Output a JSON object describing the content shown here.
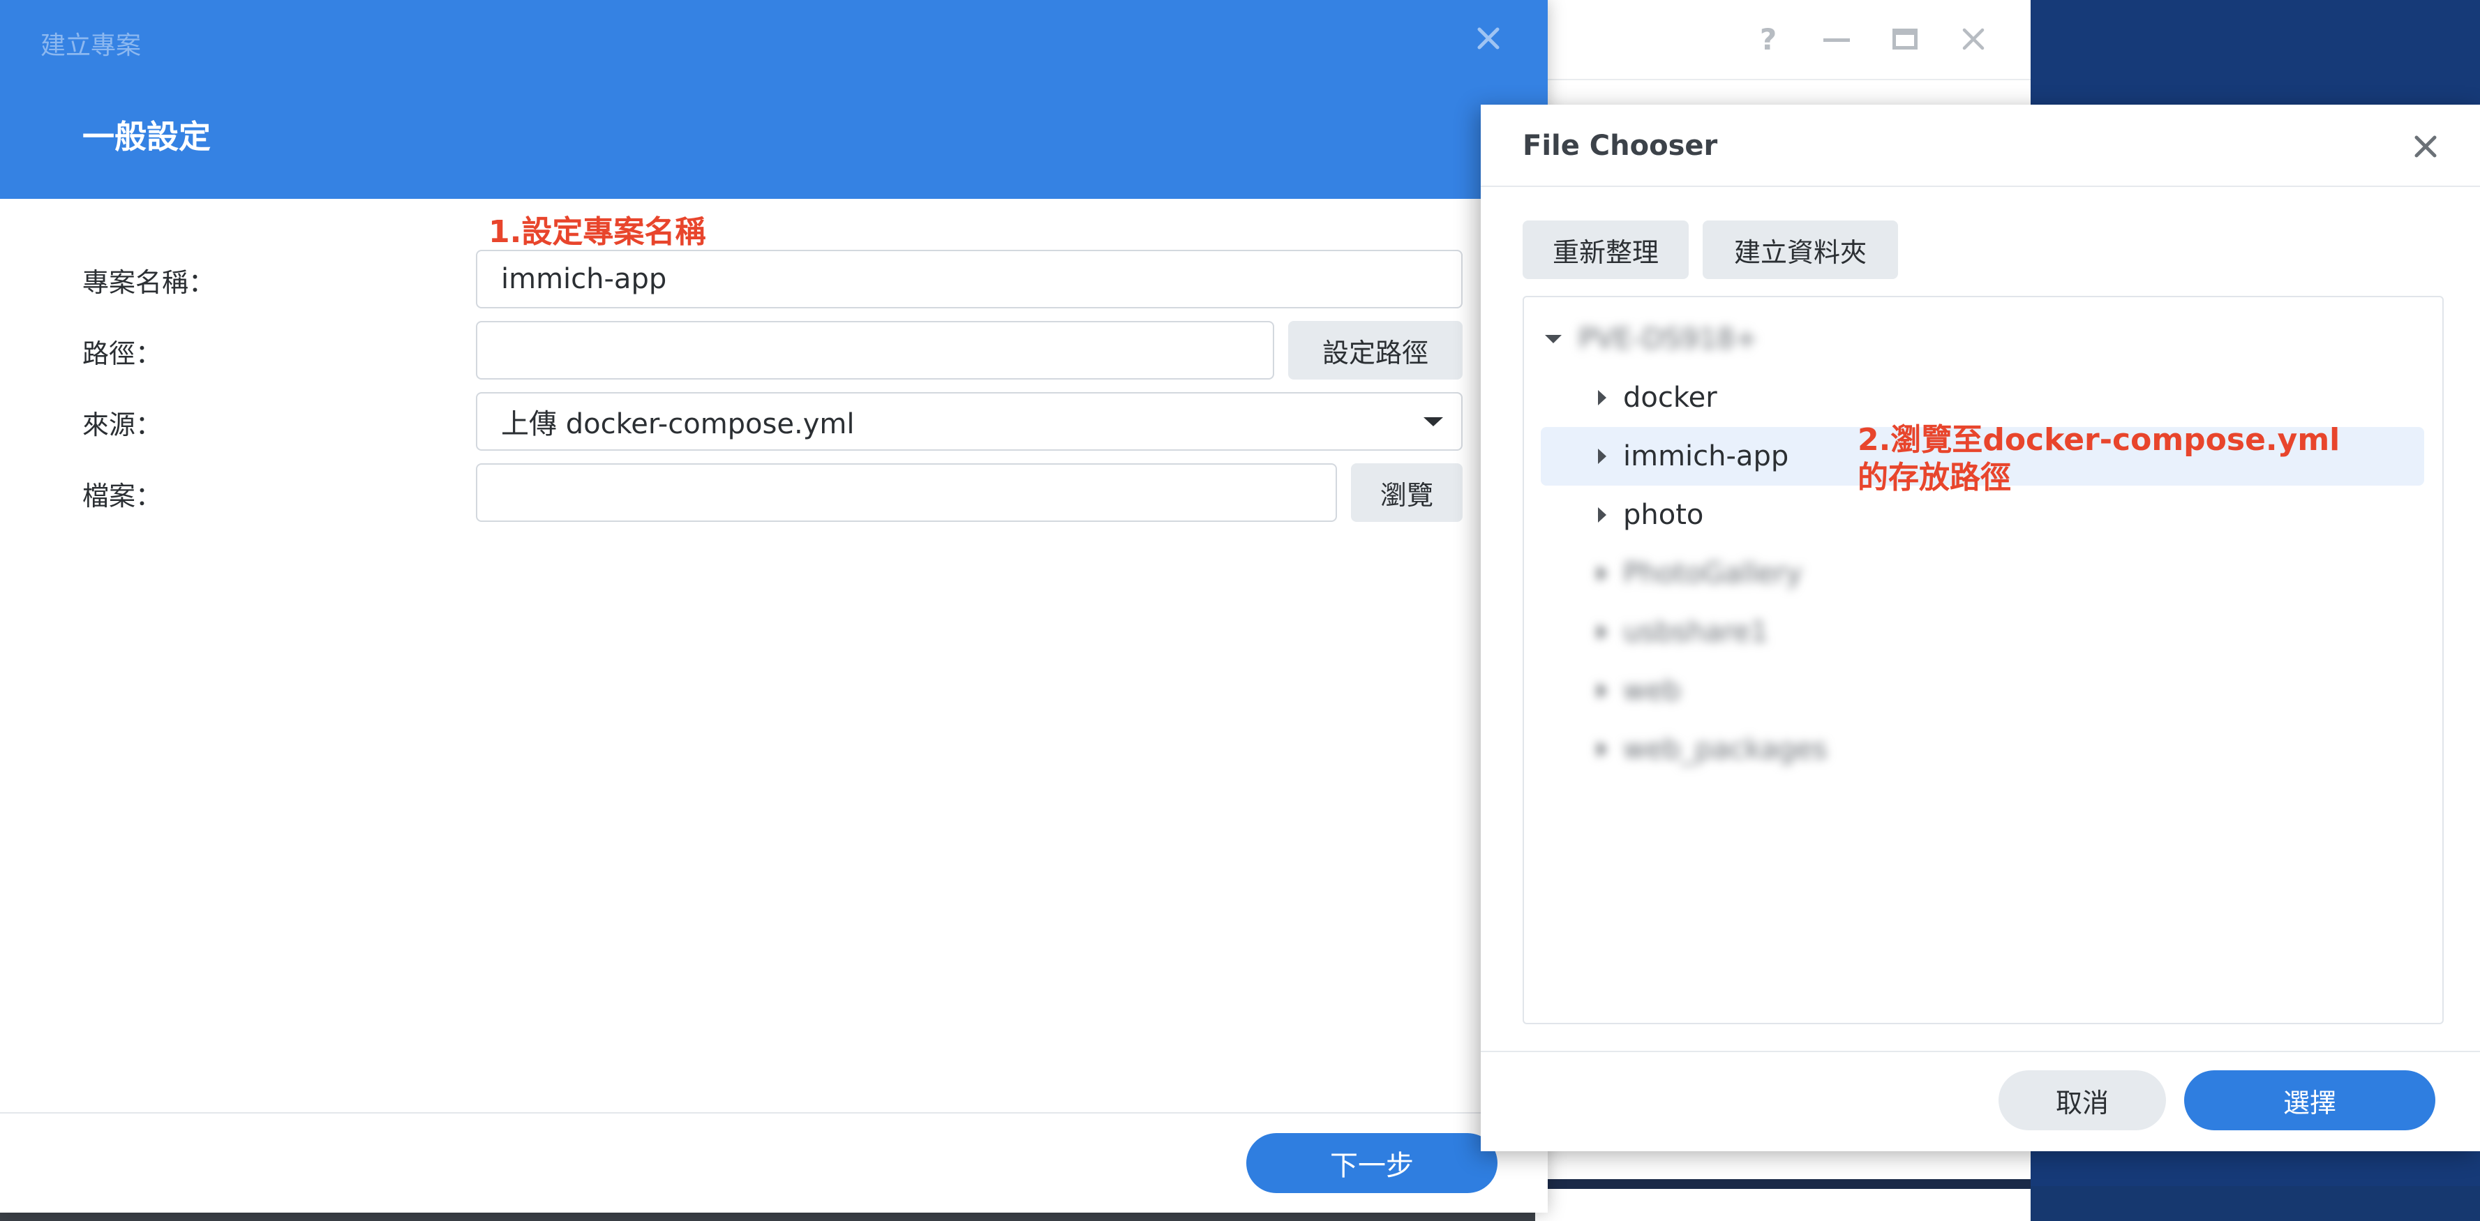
{
  "main_window": {
    "title": "建立專案",
    "section_title": "一般設定",
    "annotation": "1.設定專案名稱",
    "fields": {
      "project_name_label": "專案名稱：",
      "project_name_value": "immich-app",
      "path_label": "路徑：",
      "path_value": "",
      "set_path_button": "設定路徑",
      "source_label": "來源：",
      "source_value": "上傳 docker-compose.yml",
      "file_label": "檔案：",
      "file_value": "",
      "browse_button": "瀏覽"
    },
    "next_button": "下一步"
  },
  "back_window": {
    "help_glyph": "?"
  },
  "file_chooser": {
    "title": "File Chooser",
    "refresh_button": "重新整理",
    "new_folder_button": "建立資料夾",
    "tree": {
      "root": "PVE-DS918+",
      "items": [
        {
          "label": "docker"
        },
        {
          "label": "immich-app",
          "selected": true
        },
        {
          "label": "photo"
        },
        {
          "label": "PhotoGallery",
          "obscured": true
        },
        {
          "label": "usbshare1",
          "obscured": true
        },
        {
          "label": "web",
          "obscured": true
        },
        {
          "label": "web_packages",
          "obscured": true
        }
      ]
    },
    "annotation_line1": "2.瀏覽至docker-compose.yml",
    "annotation_line2": "的存放路徑",
    "cancel_button": "取消",
    "select_button": "選擇"
  },
  "colors": {
    "header_blue": "#3582e3",
    "primary_button": "#2f7ee0",
    "annotation_red": "#e8452c",
    "selected_row": "#e9f1fc"
  }
}
